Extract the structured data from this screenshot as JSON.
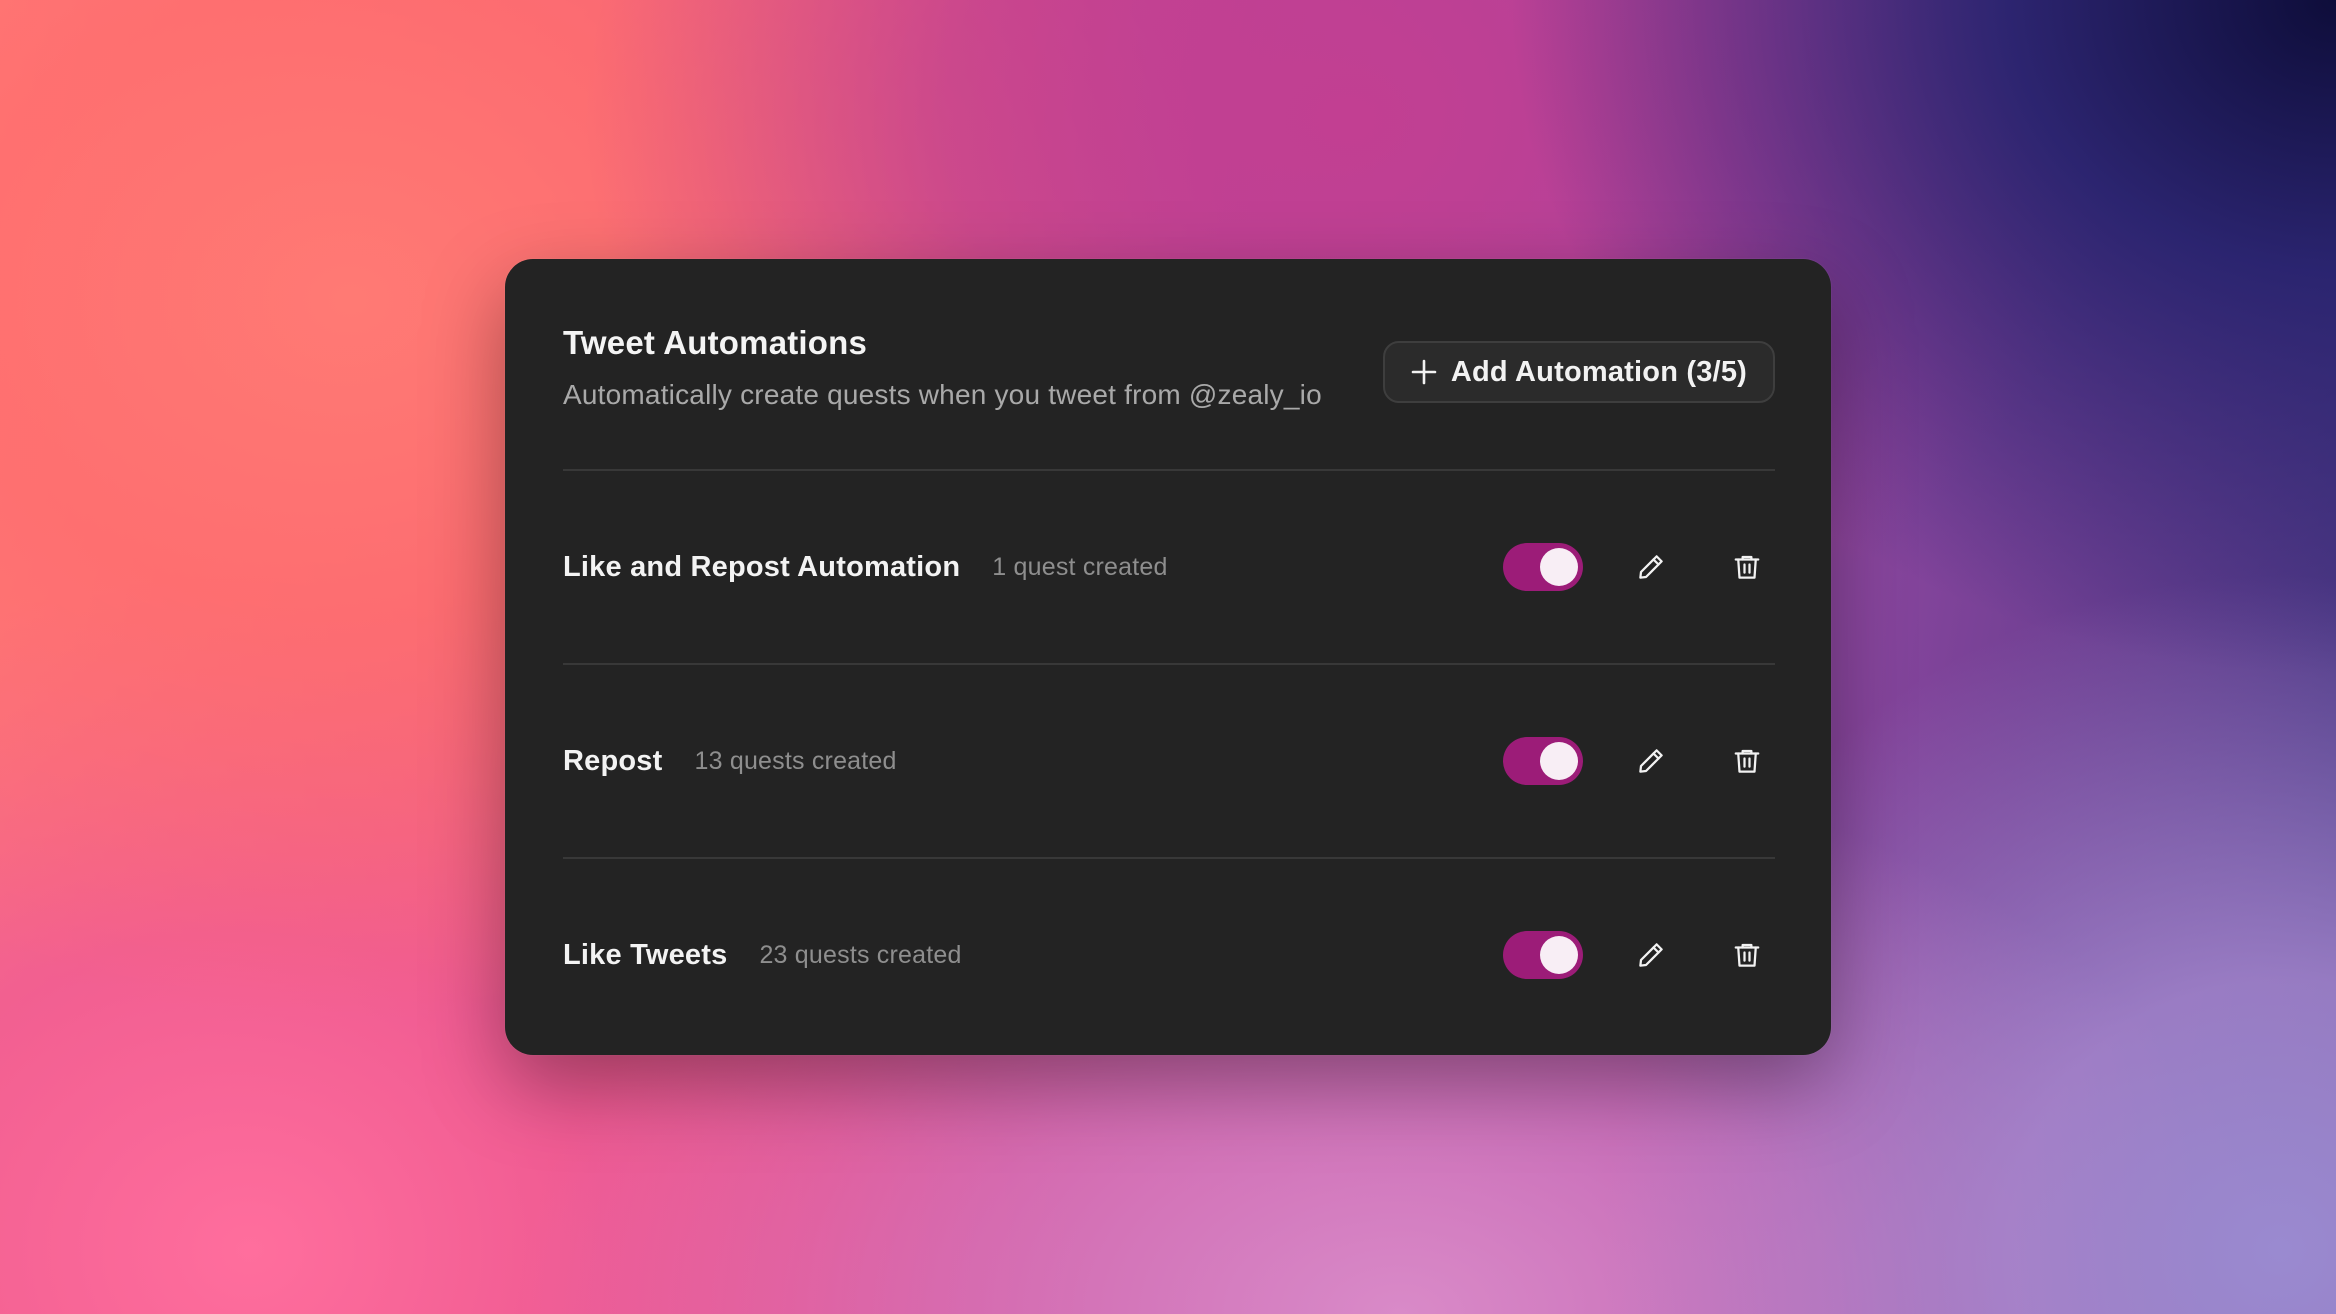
{
  "card": {
    "title": "Tweet Automations",
    "subtitle": "Automatically create quests when you tweet from @zealy_io",
    "add_button": {
      "label": "Add Automation (3/5)",
      "icon": "plus-icon"
    }
  },
  "automations": [
    {
      "name": "Like and Repost Automation",
      "count": "1 quest created",
      "enabled": true,
      "toggle_icon": "toggle-switch",
      "edit_icon": "pencil-icon",
      "delete_icon": "trash-icon"
    },
    {
      "name": "Repost",
      "count": "13 quests created",
      "enabled": true,
      "toggle_icon": "toggle-switch",
      "edit_icon": "pencil-icon",
      "delete_icon": "trash-icon"
    },
    {
      "name": "Like Tweets",
      "count": "23 quests created",
      "enabled": true,
      "toggle_icon": "toggle-switch",
      "edit_icon": "pencil-icon",
      "delete_icon": "trash-icon"
    }
  ],
  "colors": {
    "toggle_on": "#9c1c78",
    "card_background": "#232323",
    "background_from": "#ff7e7a",
    "background_to": "#0e0d3a"
  }
}
